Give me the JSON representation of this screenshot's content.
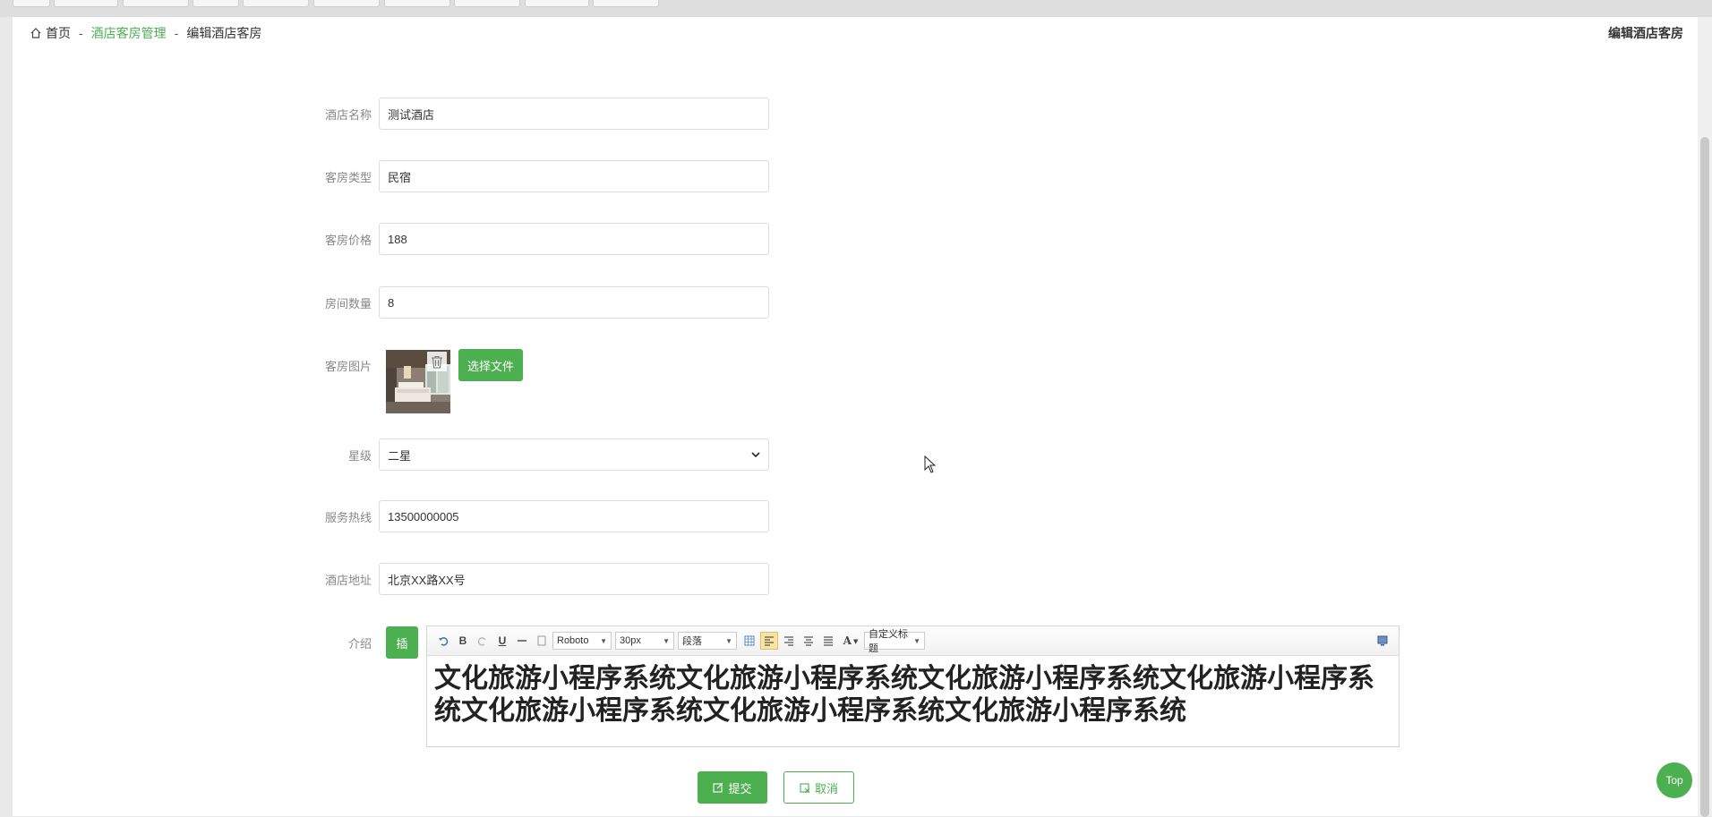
{
  "breadcrumb": {
    "home": "首页",
    "sep1": "-",
    "section": "酒店客房管理",
    "sep2": "-",
    "current": "编辑酒店客房"
  },
  "page_title": "编辑酒店客房",
  "form": {
    "hotel_name": {
      "label": "酒店名称",
      "value": "测试酒店"
    },
    "room_type": {
      "label": "客房类型",
      "value": "民宿"
    },
    "room_price": {
      "label": "客房价格",
      "value": "188"
    },
    "room_count": {
      "label": "房间数量",
      "value": "8"
    },
    "room_image": {
      "label": "客房图片",
      "choose_label": "选择文件"
    },
    "star": {
      "label": "星级",
      "value": "二星"
    },
    "hotline": {
      "label": "服务热线",
      "value": "13500000005"
    },
    "address": {
      "label": "酒店地址",
      "value": "北京XX路XX号"
    },
    "intro": {
      "label": "介绍",
      "insert_label": "插",
      "toolbar": {
        "font": "Roboto",
        "size": "30px",
        "paragraph": "段落",
        "custom_heading": "自定义标题",
        "bold": "B",
        "underline": "U",
        "font_color": "A"
      },
      "content": "文化旅游小程序系统文化旅游小程序系统文化旅游小程序系统文化旅游小程序系统文化旅游小程序系统文化旅游小程序系统文化旅游小程序系统"
    }
  },
  "actions": {
    "submit": "提交",
    "cancel": "取消",
    "top": "Top"
  },
  "colors": {
    "accent": "#4caf50"
  }
}
